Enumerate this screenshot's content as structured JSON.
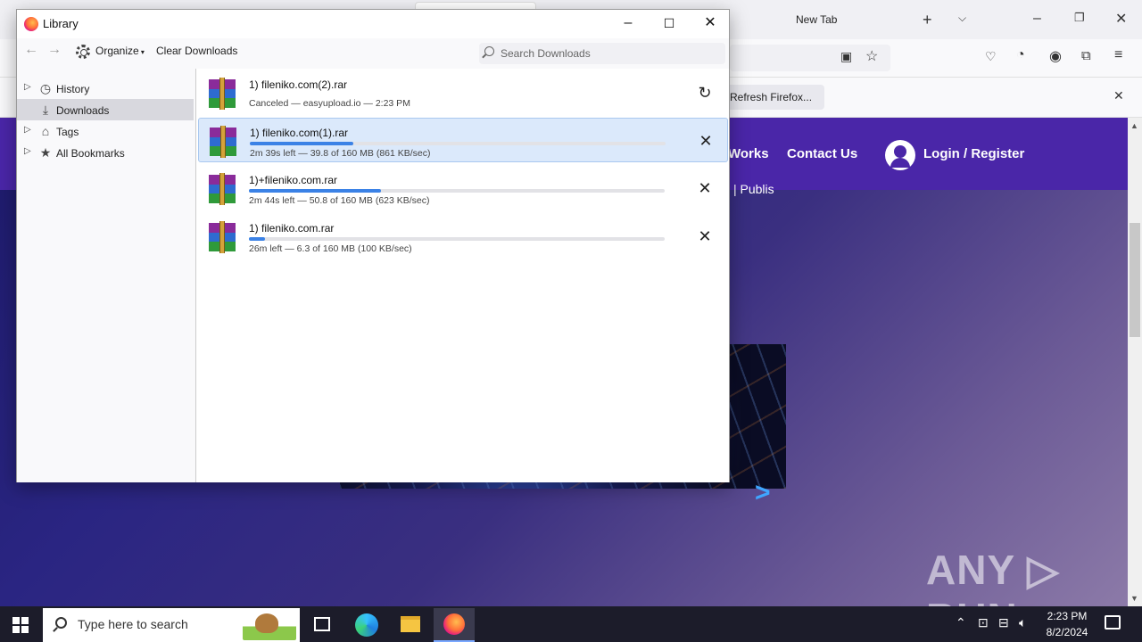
{
  "browser": {
    "new_tab_label": "New Tab",
    "notification": {
      "refresh_button": "Refresh Firefox..."
    },
    "site": {
      "nav_works": "Works",
      "nav_contact": "Contact Us",
      "nav_login": "Login / Register",
      "sub_text": "| Publis",
      "watermark": "ANY ▷ RUN"
    }
  },
  "library": {
    "title": "Library",
    "toolbar": {
      "organize_label": "Organize",
      "clear_downloads_label": "Clear Downloads",
      "search_placeholder": "Search Downloads"
    },
    "sidebar": {
      "items": [
        {
          "label": "History",
          "icon": "clock-icon",
          "selected": false
        },
        {
          "label": "Downloads",
          "icon": "download-icon",
          "selected": true
        },
        {
          "label": "Tags",
          "icon": "tag-icon",
          "selected": false
        },
        {
          "label": "All Bookmarks",
          "icon": "star-icon",
          "selected": false
        }
      ]
    },
    "downloads": [
      {
        "name": "1) fileniko.com(2).rar",
        "status": "Canceled — easyupload.io — 2:23 PM",
        "progress": null,
        "action": "retry-icon",
        "selected": false
      },
      {
        "name": "1) fileniko.com(1).rar",
        "status": "2m 39s left — 39.8 of 160 MB (861 KB/sec)",
        "progress": 0.249,
        "action": "cancel-icon",
        "selected": true
      },
      {
        "name": "1)+fileniko.com.rar",
        "status": "2m 44s left — 50.8 of 160 MB (623 KB/sec)",
        "progress": 0.3175,
        "action": "cancel-icon",
        "selected": false
      },
      {
        "name": "1) fileniko.com.rar",
        "status": "26m left — 6.3 of 160 MB (100 KB/sec)",
        "progress": 0.039,
        "action": "cancel-icon",
        "selected": false
      }
    ]
  },
  "taskbar": {
    "search_placeholder": "Type here to search",
    "clock_time": "2:23 PM",
    "clock_date": "8/2/2024"
  },
  "colors": {
    "accent": "#3b82e6",
    "site_header": "#4a26a8",
    "selection": "#dbe9fb"
  }
}
